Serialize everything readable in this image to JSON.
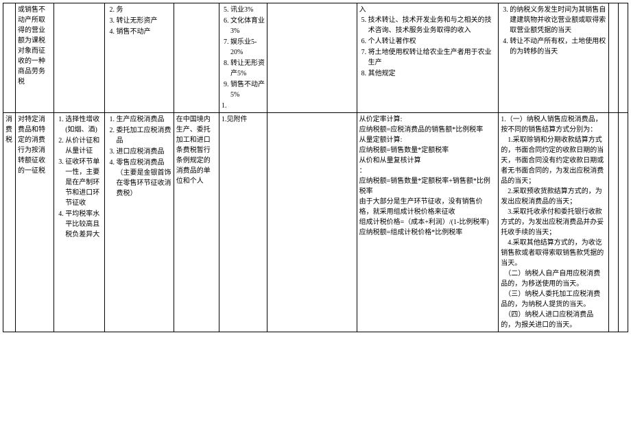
{
  "row1": {
    "c0": "",
    "c1": "或销售不动产所取得的营业额为课税对象而征收的一种商品劳务税",
    "c2": "",
    "c3_items": [
      "务",
      "转让无形资产",
      "销售不动产"
    ],
    "c3_start": 2,
    "c4": "",
    "c5_items": [
      "讯业3%",
      "文化体育业3%",
      "娱乐业5-20%",
      "转让无形资产5%",
      "销售不动产5%"
    ],
    "c5_start": 5,
    "c5_tail": "1.",
    "c6": "",
    "c7_pre": "入",
    "c7_items": [
      "技术转让、技术开发业务和与之相关的技术咨询、技术服务业务取得的收入",
      "个人转让著作权",
      "将土地使用权转让给农业生产者用于农业生产",
      "其他规定"
    ],
    "c7_start": 5,
    "c8_items": [
      "的纳税义务发生时间为其销售自建建筑物并收讫营业额或取得索取营业额凭据的当天",
      "转让不动产所有权，土地使用权的为转移的当天"
    ],
    "c8_start": 3,
    "c9": "",
    "c10": ""
  },
  "row2": {
    "c0": "消费税",
    "c1": "对特定消费品和特定的消费行为按消转额征收的一征税",
    "c2_items": [
      "选择性增收(如烟、酒)",
      "从价计征和从量计征",
      "征收环节单一性，主要是在产制环节和进口环节征收",
      "平均税率水平比较高且税负差异大"
    ],
    "c2_start": 1,
    "c3_items": [
      "生产应税消费品",
      "委托加工应税消费品",
      "进口应税消费品",
      "零售应税消费品（主要是金银首饰在零售环节征收消费税）"
    ],
    "c3_start": 1,
    "c4": "在中国境内生产、委托加工和进口条费税暂行条例规定的消费品的单位和个人",
    "c5": "1.见附件",
    "c6": "",
    "c7": "从价定率计算:\n应纳税额=应税消费品的销售额*比例税率\n从量定额计算:\n应纳税额=销售数量*定额税率\n从价和从量复核计算\n：\n应纳税额=销售数量*定额税率+销售额*比例税率\n由于大部分是生产环节征收，没有销售价格，就采用组成计税价格来征收\n组成计税价格=（成本+利润）/(1-比例税率)\n应纳税额=组成计税价格*比例税率",
    "c8": "1.（一）纳税人销售应税消费品，按不同的销售结算方式分别为：\n　1.采取赊销和分期收款结算方式的，书面合同约定的收款日期的当天，书面合同没有约定收款日期或者无书面合同的，为发出应税消费品的当天；\n　2.采取预收货款结算方式的，为发出应税消费品的当天；\n　3.采取托收承付和委托银行收款方式的，为发出应税消费品并办妥托收手续的当天；\n　4.采取其他结算方式的，为收讫销售款或者取得索取销售款凭据的当天。\n　（二）纳税人自产自用应税消费品的，为移送使用的当天。\n　（三）纳税人委托加工应税消费品的，为纳税人提货的当天。\n　（四）纳税人进口应税消费品的，为报关进口的当天。",
    "c9": "",
    "c10": ""
  }
}
